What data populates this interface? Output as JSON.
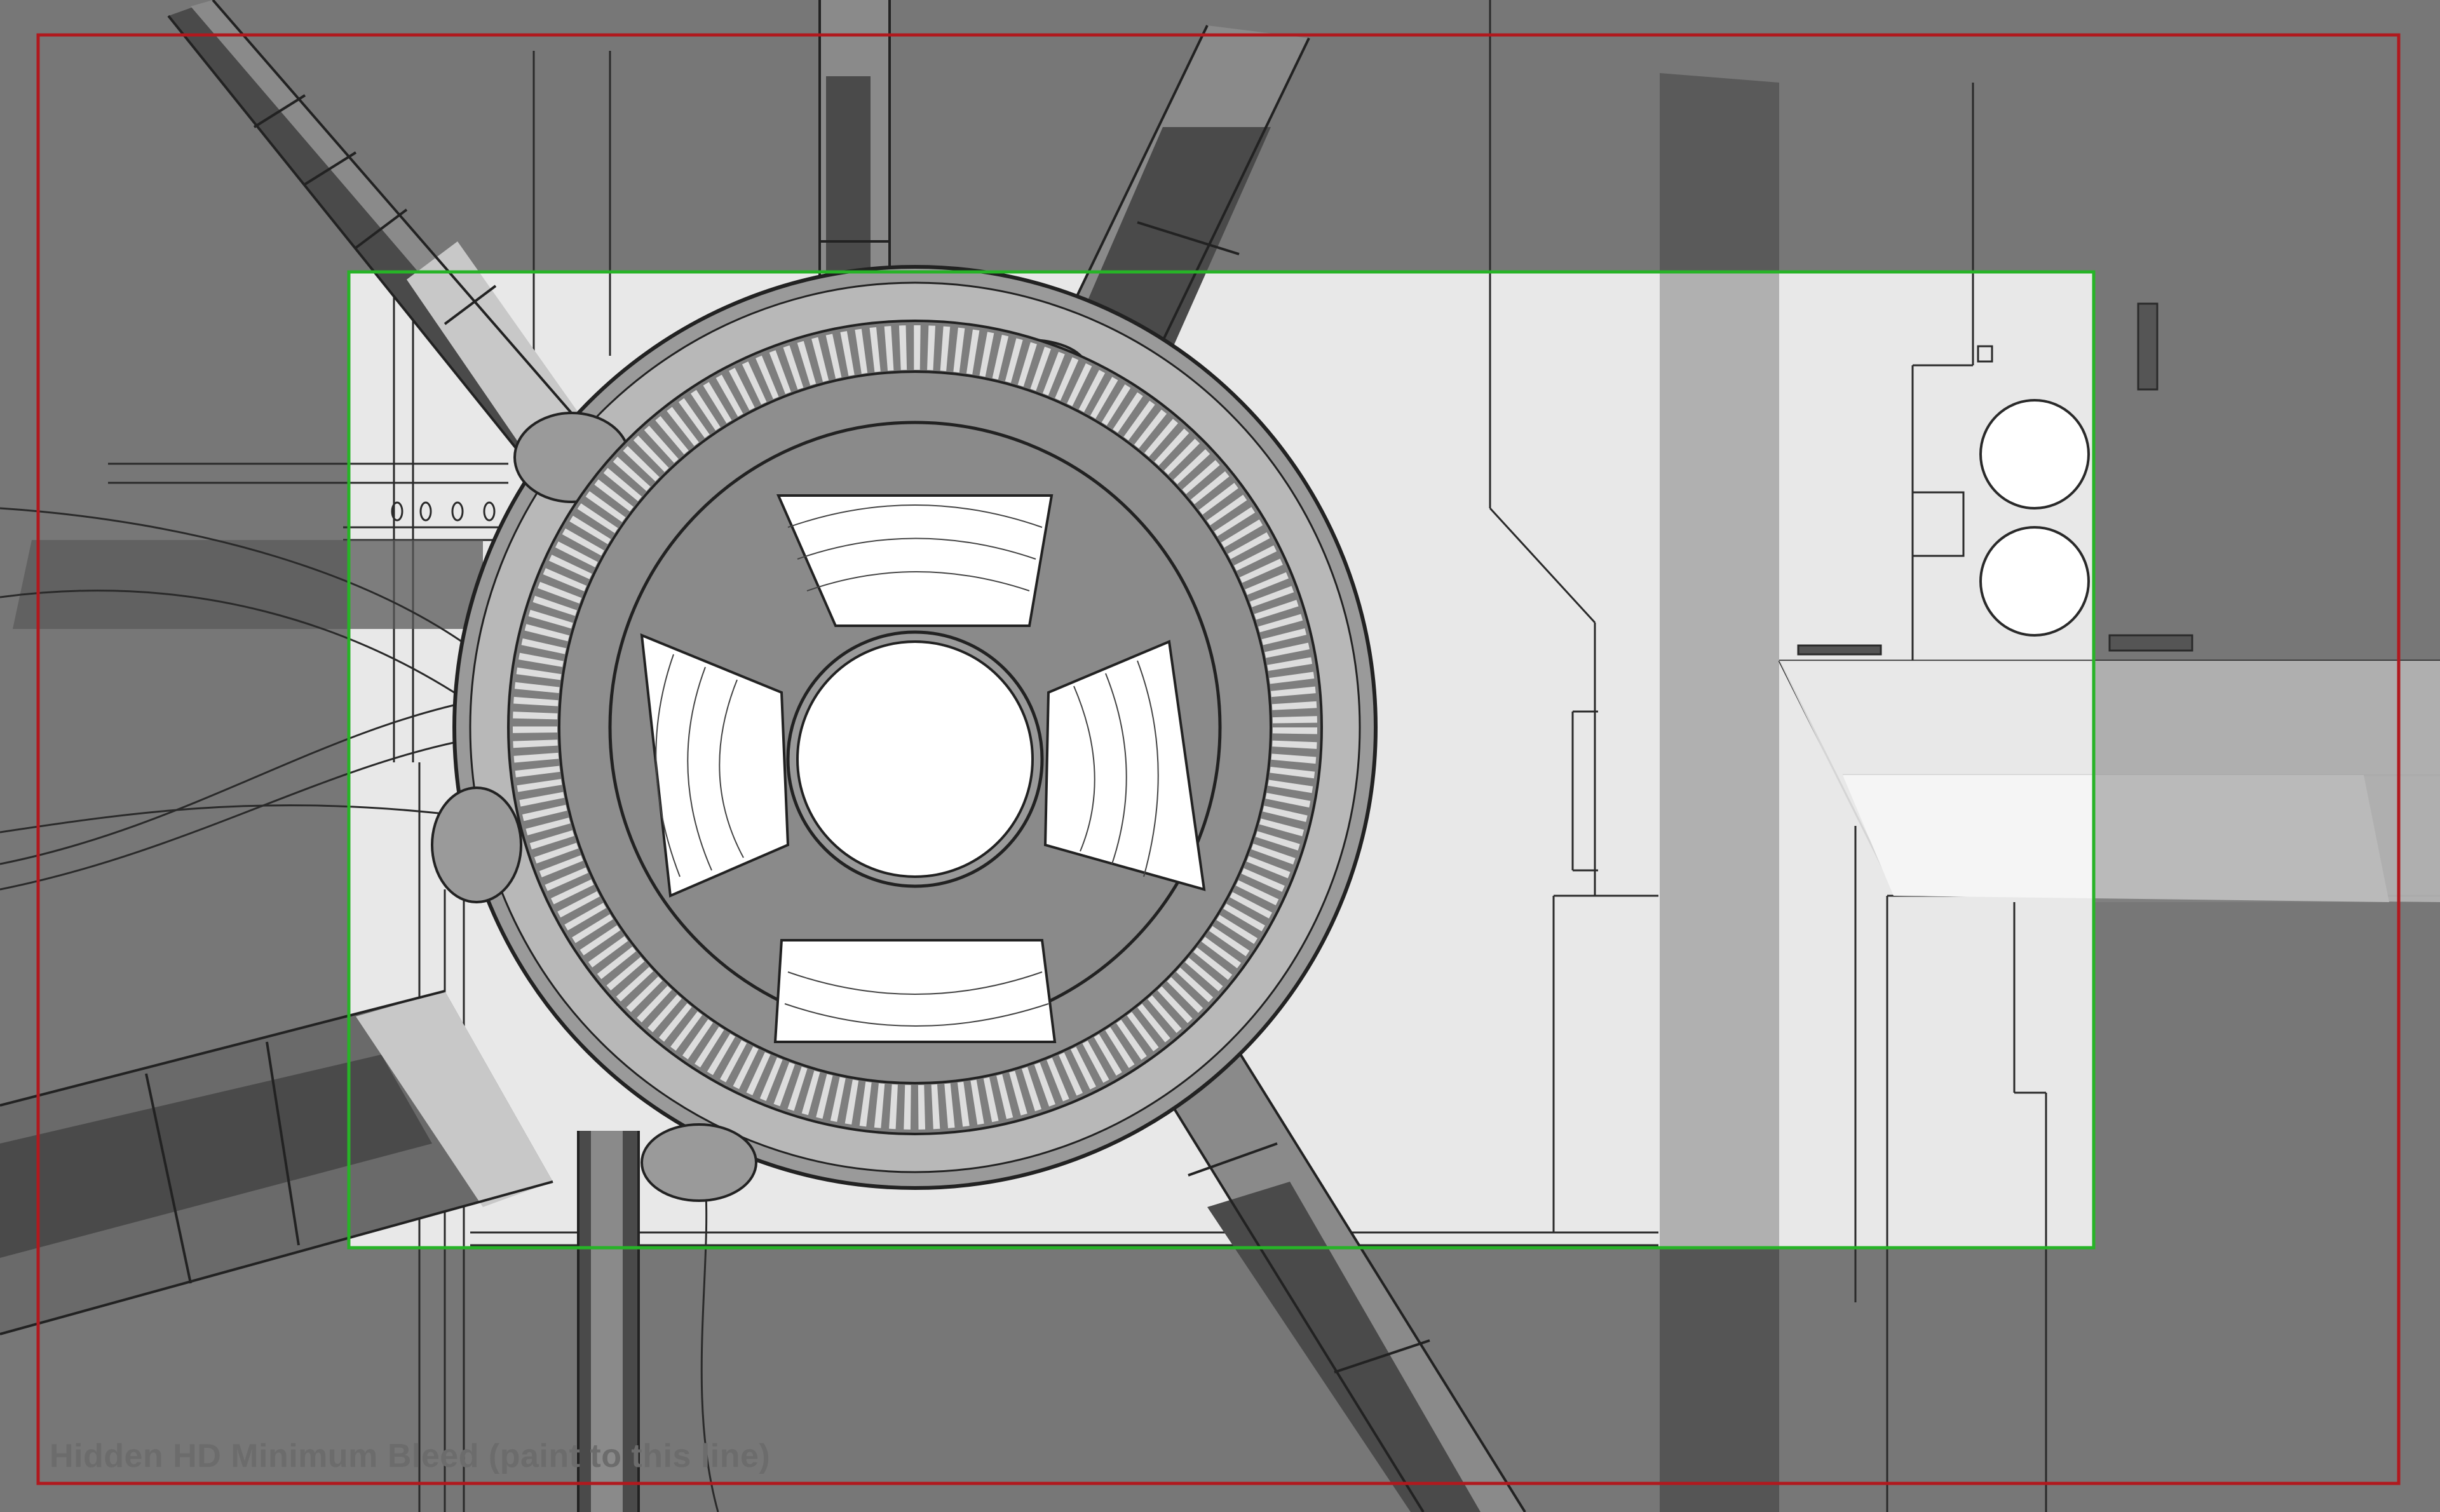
{
  "frame": {
    "caption": "Hidden HD Minimum Bleed (paint to this line)"
  },
  "colors": {
    "background": "#777777",
    "bleed_border": "#b0191e",
    "safe_area_border": "#27b327",
    "safe_area_fill": "#e8e8e8",
    "ink": "#222222",
    "pipe_dark": "#4a4a4a",
    "pipe_mid": "#8a8a8a",
    "pipe_light": "#c8c8c8",
    "wheel_body": "#9a9a9a",
    "wheel_white": "#ffffff"
  }
}
